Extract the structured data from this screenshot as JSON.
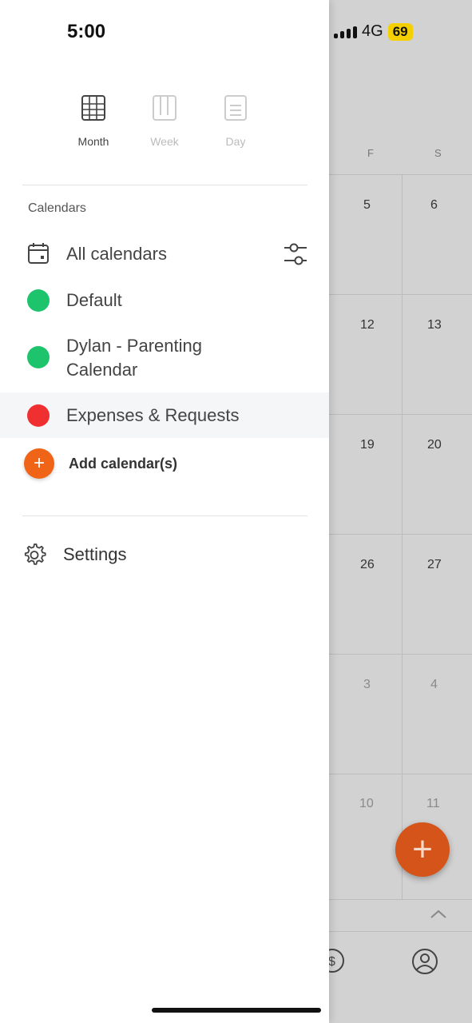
{
  "status_bar": {
    "time": "5:00",
    "network": "4G",
    "battery": "69"
  },
  "background_calendar": {
    "weekdays": [
      "F",
      "S"
    ],
    "rows": [
      [
        "5",
        "6"
      ],
      [
        "12",
        "13"
      ],
      [
        "19",
        "20"
      ],
      [
        "26",
        "27"
      ],
      [
        "3",
        "4"
      ],
      [
        "10",
        "11"
      ]
    ],
    "fab_label": "+"
  },
  "view_switcher": {
    "month": "Month",
    "week": "Week",
    "day": "Day"
  },
  "calendars": {
    "section_label": "Calendars",
    "all_label": "All calendars",
    "items": [
      {
        "label": "Default",
        "color": "#1ec46b"
      },
      {
        "label": "Dylan - Parenting Calendar",
        "color": "#1ec46b"
      },
      {
        "label": "Expenses & Requests",
        "color": "#f03030"
      }
    ],
    "add_label": "Add calendar(s)",
    "add_symbol": "+"
  },
  "settings": {
    "label": "Settings"
  }
}
